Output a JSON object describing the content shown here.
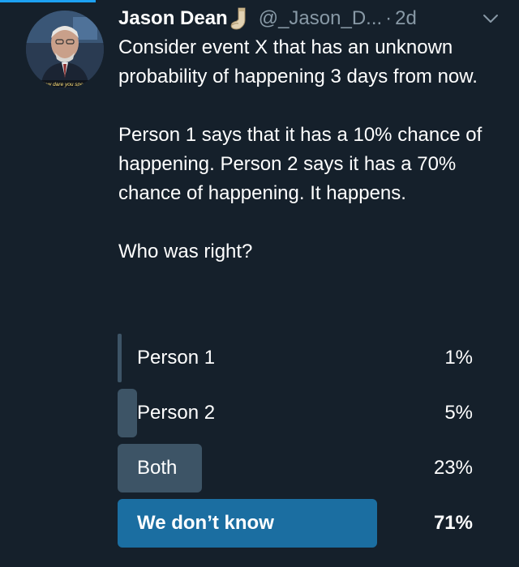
{
  "tweet": {
    "author": {
      "display_name": "Jason Dean",
      "name_emoji": "sock-icon",
      "handle": "@_Jason_D...",
      "avatar_caption": "How dare you speak"
    },
    "separator": "·",
    "time": "2d",
    "menu_icon": "chevron-down-icon",
    "text_paragraphs": [
      "Consider event X that has an unknown probability of happening 3 days from now.",
      "Person 1 says that it has a 10% chance of happening. Person 2 says it has a 70% chance of happening. It happens.",
      "Who was right?"
    ]
  },
  "poll": {
    "options": [
      {
        "label": "Person 1",
        "percent_text": "1%",
        "fraction": 0.01,
        "winner": false
      },
      {
        "label": "Person 2",
        "percent_text": "5%",
        "fraction": 0.05,
        "winner": false
      },
      {
        "label": "Both",
        "percent_text": "23%",
        "fraction": 0.23,
        "winner": false
      },
      {
        "label": "We don’t know",
        "percent_text": "71%",
        "fraction": 0.71,
        "winner": true
      }
    ]
  },
  "colors": {
    "background": "#15202b",
    "text_secondary": "#8899a6",
    "poll_bar": "#3d5466",
    "poll_bar_winner": "#1b6ea1",
    "accent": "#1da1f2"
  }
}
